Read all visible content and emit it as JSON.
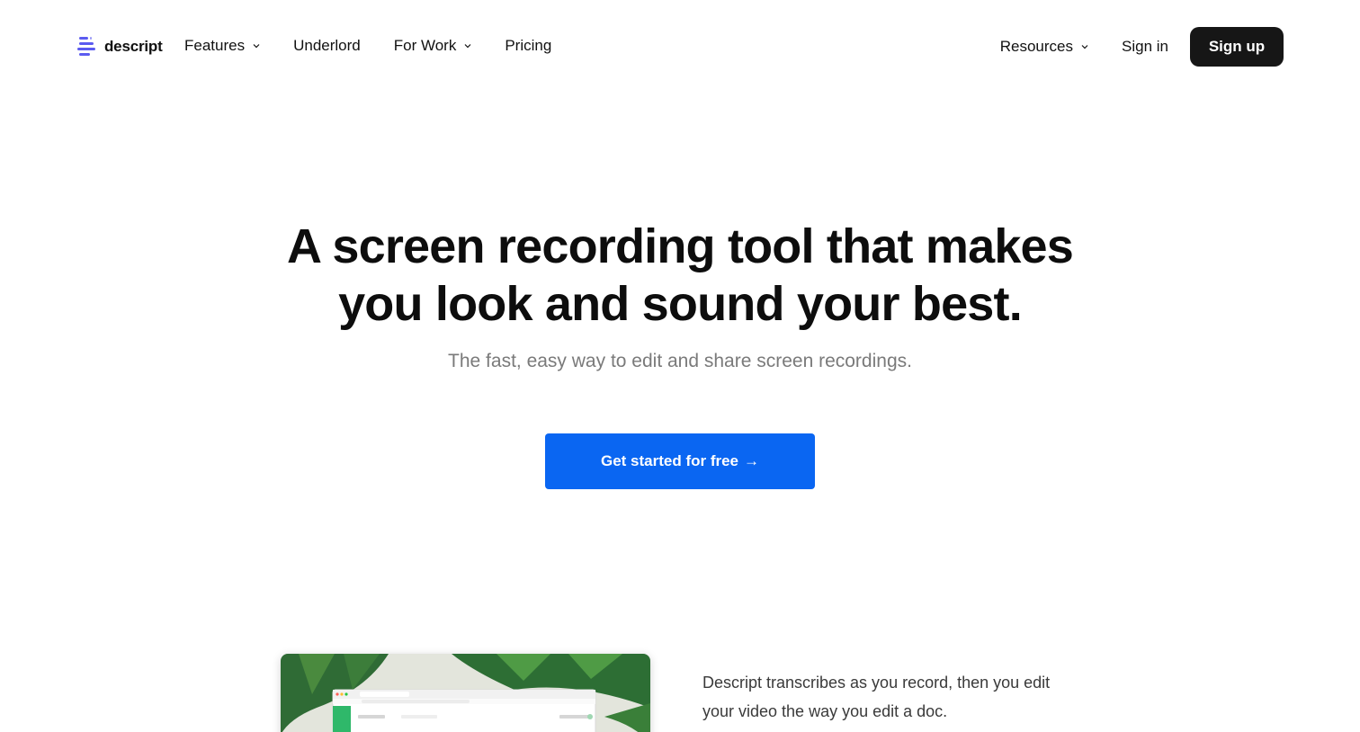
{
  "header": {
    "logo_text": "descript",
    "nav_left": [
      {
        "label": "Features"
      },
      {
        "label": "Underlord"
      },
      {
        "label": "For Work"
      },
      {
        "label": "Pricing"
      }
    ],
    "resources_label": "Resources",
    "signin_label": "Sign in",
    "signup_label": "Sign up"
  },
  "hero": {
    "title_line1": "A screen recording tool that makes",
    "title_line2": "you look and sound your best.",
    "subtitle": "The fast, easy way to edit and share screen recordings.",
    "cta_label": "Get started for free",
    "cta_arrow": "→"
  },
  "feature": {
    "description": "Descript transcribes as you record, then you edit your video the way you edit a doc."
  },
  "colors": {
    "cta_blue": "#0a66f2",
    "signup_bg": "#161616",
    "logo_accent": "#5b5bf0",
    "subtitle_gray": "#7a7a7a"
  }
}
